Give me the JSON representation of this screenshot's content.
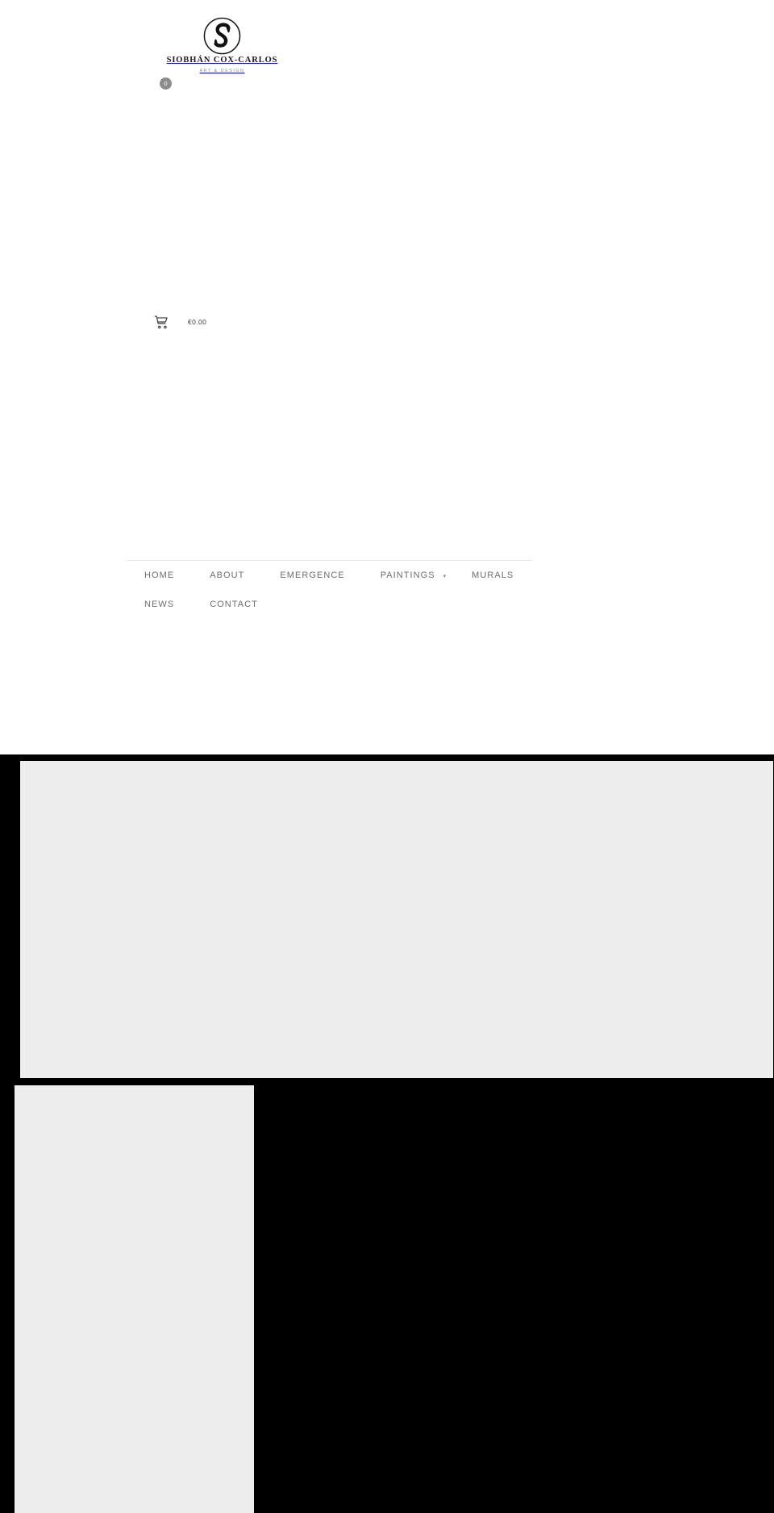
{
  "site": {
    "brand_name": "SIOBHÁN COX-CARLOS",
    "brand_tagline": "ART & DESIGN",
    "logo_monogram": "S"
  },
  "cart": {
    "badge_count": "0",
    "total": "€0.00",
    "icon": "shopping-cart-icon"
  },
  "nav": {
    "items": [
      {
        "label": "HOME",
        "has_dropdown": false
      },
      {
        "label": "ABOUT",
        "has_dropdown": false
      },
      {
        "label": "EMERGENCE",
        "has_dropdown": false
      },
      {
        "label": "PAINTINGS",
        "has_dropdown": true,
        "caret": "▾"
      },
      {
        "label": "MURALS",
        "has_dropdown": false
      },
      {
        "label": "NEWS",
        "has_dropdown": false
      },
      {
        "label": "CONTACT",
        "has_dropdown": false
      }
    ]
  },
  "colors": {
    "page_background": "#000000",
    "header_background": "#ffffff",
    "placeholder": "#ededed",
    "nav_text": "#6e6e6e",
    "badge": "#8c8c8c",
    "brand_text": "#1a1a1a",
    "tagline_text": "#8a8a8a"
  }
}
